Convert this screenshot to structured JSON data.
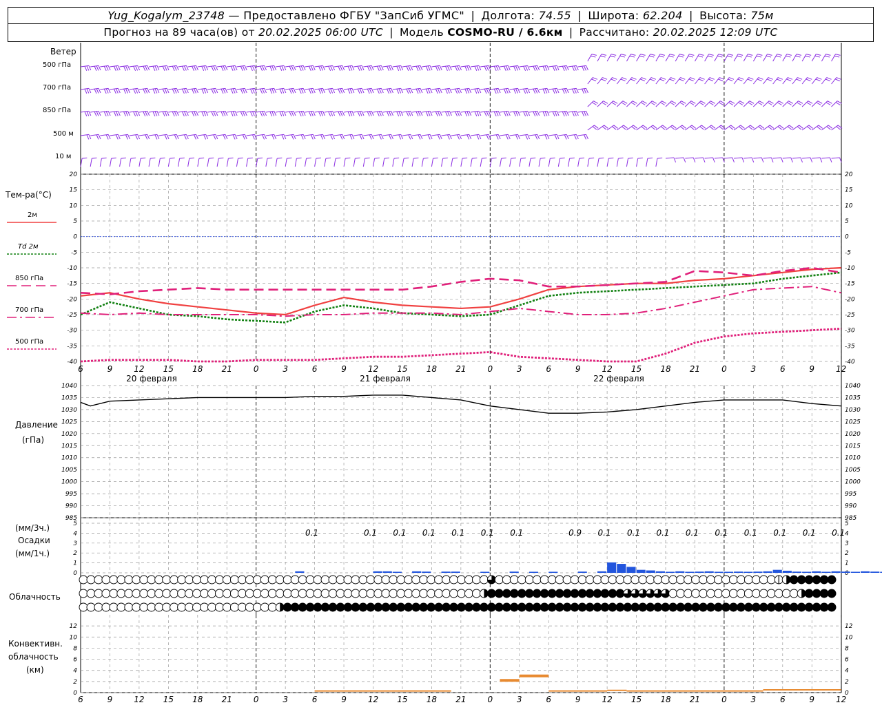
{
  "header": {
    "station": "Yug_Kogalym_23748",
    "provider": "Предоставлено ФГБУ \"ЗапСиб УГМС\"",
    "lon_label": "Долгота:",
    "lon": "74.55",
    "lat_label": "Широта:",
    "lat": "62.204",
    "alt_label": "Высота:",
    "alt": "75м",
    "forecast_label": "Прогноз на 89 часа(ов) от",
    "forecast_from": "20.02.2025 06:00 UTC",
    "model_label": "Модель",
    "model": "COSMO-RU / 6.6км",
    "computed_label": "Рассчитано:",
    "computed": "20.02.2025 12:09 UTC"
  },
  "panels": {
    "wind": {
      "title": "Ветер",
      "levels": [
        "500 гПа",
        "700 гПа",
        "850 гПа",
        "500 м",
        "10 м"
      ]
    },
    "temp": {
      "title": "Тем-ра(°C)",
      "legend": [
        "2м",
        "Td 2м",
        "850 гПа",
        "700 гПа",
        "500 гПа"
      ]
    },
    "pressure": {
      "title": "Давление",
      "unit": "(гПа)"
    },
    "precip": {
      "unit_3h": "(мм/3ч.)",
      "title": "Осадки",
      "unit_1h": "(мм/1ч.)"
    },
    "cloud": {
      "title": "Облачность"
    },
    "convective": {
      "title_1": "Конвективн.",
      "title_2": "облачность",
      "unit": "(км)"
    }
  },
  "time_axis": {
    "hour_labels": [
      "6",
      "9",
      "12",
      "15",
      "18",
      "21",
      "0",
      "3",
      "6",
      "9",
      "12",
      "15",
      "18",
      "21",
      "0",
      "3",
      "6",
      "9",
      "12",
      "15",
      "18",
      "21",
      "0",
      "3",
      "6",
      "9",
      "12"
    ],
    "date_labels": [
      "20 февраля",
      "21 февраля",
      "22 февраля"
    ]
  },
  "colors": {
    "t2m": "#f04040",
    "td2m": "#108010",
    "t850": "#e0207a",
    "t700": "#e0207a",
    "t500": "#e0207a",
    "wind": "#8a2be2",
    "precip": "#2255dd",
    "convective": "#e88a30",
    "zero_line": "#3050e0"
  },
  "chart_data": [
    {
      "type": "line",
      "title": "Тем-ра(°C)",
      "x_hours": [
        0,
        3,
        6,
        9,
        12,
        15,
        18,
        21,
        24,
        27,
        30,
        33,
        36,
        39,
        42,
        45,
        48,
        51,
        54,
        57,
        60,
        63,
        66,
        69,
        72,
        75,
        78
      ],
      "ylim": [
        -40,
        20
      ],
      "yticks": [
        20,
        15,
        10,
        5,
        0,
        -5,
        -10,
        -15,
        -20,
        -25,
        -30,
        -35,
        -40
      ],
      "series": [
        {
          "name": "2м",
          "values": [
            -19,
            -18,
            -20,
            -21.5,
            -22.5,
            -23.5,
            -24.5,
            -25,
            -22,
            -19.5,
            -21,
            -22,
            -22.5,
            -23,
            -22.5,
            -20,
            -17,
            -16,
            -15.5,
            -15,
            -15,
            -14,
            -13.5,
            -12.5,
            -11.5,
            -10.5,
            -10
          ]
        },
        {
          "name": "Td 2м",
          "values": [
            -25,
            -21,
            -23,
            -25,
            -25.5,
            -26.5,
            -27,
            -27.5,
            -24,
            -22,
            -23,
            -24.5,
            -25,
            -25.5,
            -25,
            -22,
            -19,
            -18,
            -17.5,
            -17,
            -16.5,
            -16,
            -15.5,
            -15,
            -13.5,
            -12.5,
            -11.5
          ]
        },
        {
          "name": "850 гПа",
          "values": [
            -18,
            -18.5,
            -17.5,
            -17,
            -16.5,
            -17,
            -17,
            -17,
            -17,
            -17,
            -17,
            -17,
            -16,
            -14.5,
            -13.5,
            -14,
            -16,
            -16,
            -15.5,
            -15,
            -14.5,
            -11,
            -11.5,
            -12.5,
            -11,
            -10,
            -11.5
          ]
        },
        {
          "name": "700 гПа",
          "values": [
            -24.5,
            -25,
            -24.5,
            -25,
            -25,
            -25,
            -25,
            -25.5,
            -25,
            -25,
            -24.5,
            -24.5,
            -24.5,
            -25,
            -24,
            -23,
            -24,
            -25,
            -25,
            -24.5,
            -23,
            -21,
            -19,
            -17,
            -16.5,
            -16,
            -18
          ]
        },
        {
          "name": "500 гПа",
          "values": [
            -40,
            -39.5,
            -39.5,
            -39.5,
            -40,
            -40,
            -39.5,
            -39.5,
            -39.5,
            -39,
            -38.5,
            -38.5,
            -38,
            -37.5,
            -37,
            -38.5,
            -39,
            -39.5,
            -40,
            -40,
            -37.5,
            -34,
            -32,
            -31,
            -30.5,
            -30,
            -29.5
          ]
        }
      ]
    },
    {
      "type": "line",
      "title": "Давление",
      "ylabel": "(гПа)",
      "x_hours": [
        0,
        1,
        3,
        6,
        9,
        12,
        15,
        18,
        21,
        24,
        27,
        30,
        33,
        36,
        39,
        42,
        45,
        48,
        51,
        54,
        57,
        60,
        63,
        66,
        69,
        72,
        75,
        78
      ],
      "ylim": [
        985,
        1040
      ],
      "yticks": [
        1040,
        1035,
        1030,
        1025,
        1020,
        1015,
        1010,
        1005,
        1000,
        995,
        990,
        985
      ],
      "values": [
        1033,
        1031.5,
        1033.5,
        1034,
        1034.5,
        1035,
        1035,
        1035,
        1035,
        1035.5,
        1035.5,
        1036,
        1036,
        1035,
        1034,
        1031.5,
        1030,
        1028.5,
        1028.5,
        1029,
        1030,
        1031.5,
        1033,
        1034,
        1034,
        1034,
        1032.5,
        1031.5
      ]
    },
    {
      "type": "bar",
      "title": "Осадки",
      "ylim": [
        0,
        5
      ],
      "yticks": [
        5,
        4,
        3,
        2,
        1,
        0
      ],
      "x_hours_labeled": [
        24,
        30,
        33,
        36,
        39,
        42,
        45,
        51,
        54,
        57,
        60,
        63,
        66,
        69,
        72,
        75,
        78
      ],
      "totals_3h": [
        "0.1",
        "0.1",
        "0.1",
        "0.1",
        "0.1",
        "0.1",
        "0.1",
        "0.9",
        "0.1",
        "0.1",
        "0.1",
        "0.1",
        "0.1",
        "0.1",
        "0.1",
        "0.1",
        "0.1"
      ],
      "hourly_mm": [
        0,
        0,
        0,
        0,
        0,
        0,
        0,
        0,
        0,
        0,
        0,
        0,
        0,
        0,
        0,
        0,
        0,
        0,
        0,
        0,
        0,
        0,
        0.05,
        0,
        0,
        0,
        0,
        0,
        0,
        0,
        0.05,
        0.05,
        0.03,
        0,
        0.05,
        0.04,
        0,
        0.04,
        0.04,
        0,
        0,
        0.03,
        0,
        0,
        0.04,
        0,
        0.02,
        0,
        0.03,
        0,
        0,
        0.04,
        0,
        0.05,
        0.35,
        0.3,
        0.2,
        0.1,
        0.08,
        0.05,
        0.03,
        0.05,
        0.03,
        0.04,
        0.05,
        0.02,
        0.03,
        0.04,
        0.02,
        0.04,
        0.05,
        0.1,
        0.07,
        0.04,
        0.03,
        0.05,
        0.03,
        0.05,
        0.04,
        0.02,
        0.05,
        0.04,
        0.03,
        0.04,
        0.02,
        0.03,
        0.02,
        0.03,
        0.04
      ]
    },
    {
      "type": "table",
      "title": "Облачность",
      "rows_high_to_low": [
        "0000000000000000000000000000000000000000000000000000003000000000000000000000000000000000000012444444",
        "0000000000000000000000000000000000000000000000000000024444444444444444443333330000000000000000024444",
        "0000000000000000000000000024444444444444444444444444444444444444444444444444444444444444444444444444"
      ]
    },
    {
      "type": "bar",
      "title": "Конвективн. облачность",
      "ylabel": "(км)",
      "ylim": [
        0,
        14
      ],
      "yticks": [
        12,
        10,
        8,
        6,
        4,
        2,
        0
      ],
      "segments_km": [
        [
          24,
          38,
          0.3
        ],
        [
          43,
          45,
          2.2
        ],
        [
          45,
          48,
          3
        ],
        [
          48,
          54,
          0.3
        ],
        [
          54,
          56,
          0.4
        ],
        [
          56,
          70,
          0.3
        ],
        [
          70,
          78,
          0.5
        ]
      ]
    }
  ]
}
